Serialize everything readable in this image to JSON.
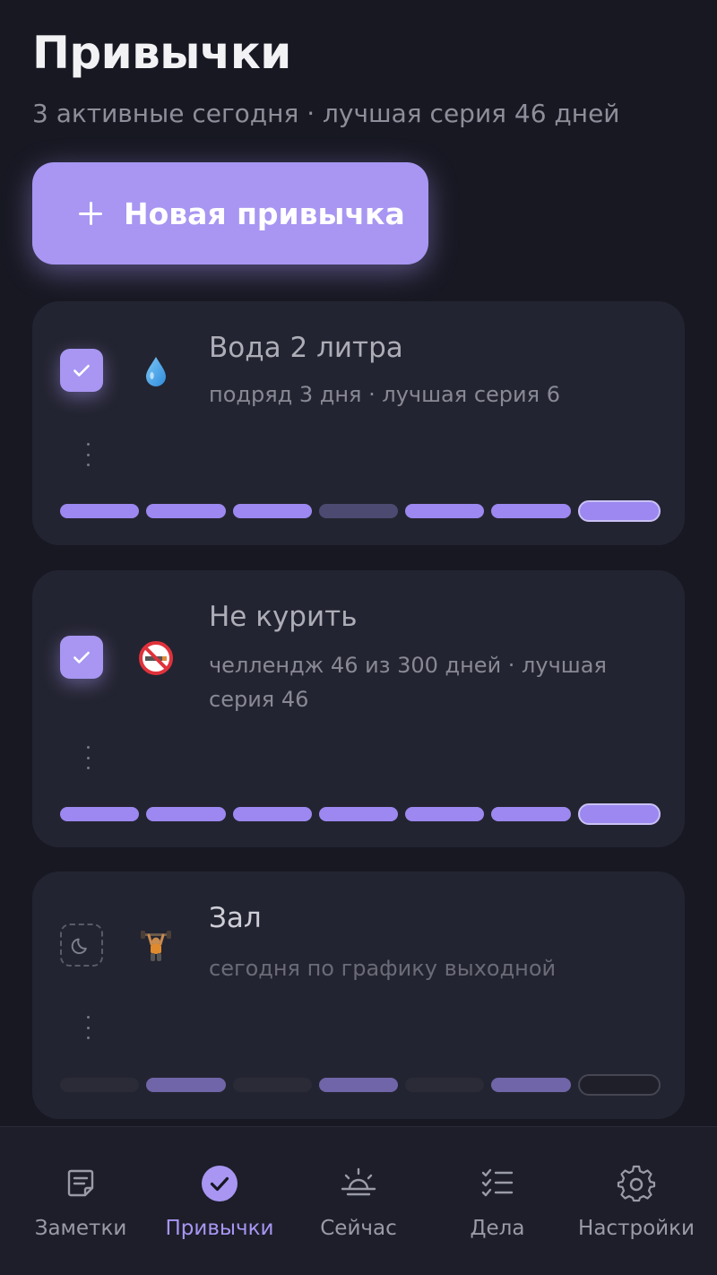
{
  "header": {
    "title": "Привычки",
    "subtitle": "3 активные сегодня · лучшая серия 46 дней"
  },
  "new_button": {
    "label": "Новая привычка",
    "icon": "plus-icon"
  },
  "habits": [
    {
      "name": "Вода 2 литра",
      "meta": "подряд 3 дня · лучшая серия 6",
      "emoji": "droplet",
      "checked": true,
      "week": [
        "done",
        "done",
        "done",
        "missed",
        "done",
        "done",
        "today-done"
      ]
    },
    {
      "name": "Не курить",
      "meta": "челлендж 46 из 300 дней · лучшая серия 46",
      "emoji": "no-smoking",
      "checked": true,
      "week": [
        "done",
        "done",
        "done",
        "done",
        "done",
        "done",
        "today-done"
      ]
    },
    {
      "name": "Зал",
      "meta": "сегодня по графику выходной",
      "emoji": "weightlifter",
      "checked": false,
      "state": "rest-day",
      "week": [
        "off",
        "done",
        "off",
        "done",
        "off",
        "done",
        "today-off"
      ]
    }
  ],
  "tabs": [
    {
      "label": "Заметки",
      "icon": "notes-icon",
      "active": false
    },
    {
      "label": "Привычки",
      "icon": "check-circle-icon",
      "active": true
    },
    {
      "label": "Сейчас",
      "icon": "sunrise-icon",
      "active": false
    },
    {
      "label": "Дела",
      "icon": "checklist-icon",
      "active": false
    },
    {
      "label": "Настройки",
      "icon": "gear-icon",
      "active": false
    }
  ],
  "colors": {
    "background": "#171822",
    "card": "#232431",
    "accent": "#A896F2"
  }
}
